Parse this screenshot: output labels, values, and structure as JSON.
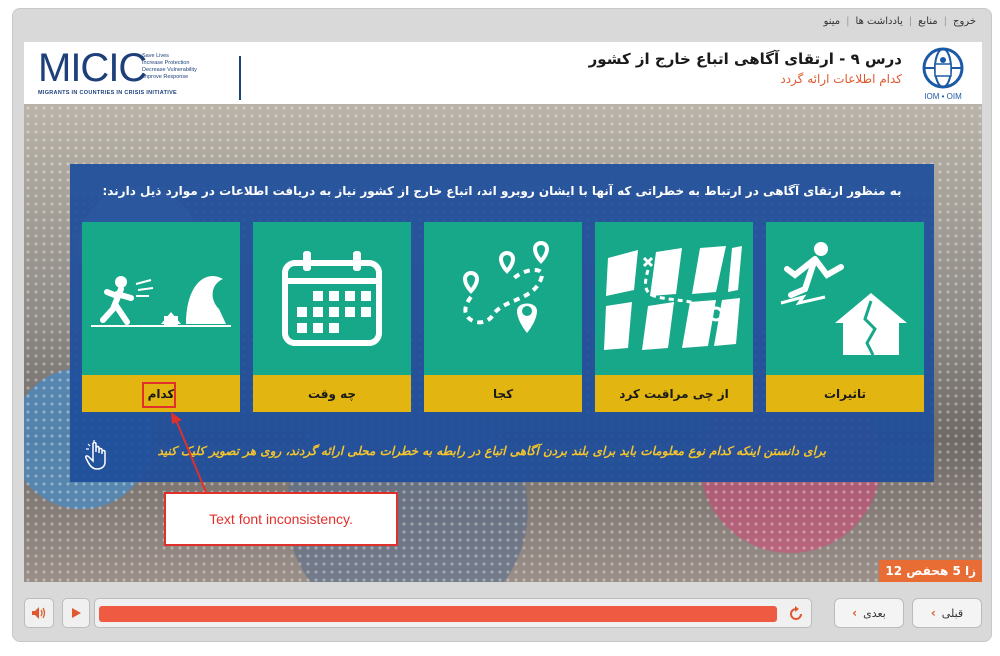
{
  "topnav": {
    "exit": "خروج",
    "resources": "منابع",
    "notes": "یادداشت ها",
    "menu": "مینو"
  },
  "header": {
    "title": "درس ۹ - ارتقای آگاهی اتباع خارج از کشور",
    "subtitle": "کدام اطلاعات ارائه گردد",
    "micic_logo": "MICIC",
    "micic_tagline": [
      "Save Lives",
      "Increase Protection",
      "Decrease Vulnerability",
      "Improve Response"
    ],
    "micic_subtitle": "MIGRANTS IN COUNTRIES IN CRISIS INITIATIVE",
    "iom_label": "IOM • OIM"
  },
  "panel": {
    "instruction": "به منظور ارتقای آگاهی در ارتباط به خطراتی که آنها با ایشان روبرو اند، اتباع خارج از کشور نیاز به دریافت اطلاعات در موارد ذیل دارند:",
    "tiles": [
      {
        "label": "تاثیرات",
        "icon": "falling-person-broken-house-icon"
      },
      {
        "label": "از چی مراقبت کرد",
        "icon": "map-route-icon"
      },
      {
        "label": "کجا",
        "icon": "location-pins-route-icon"
      },
      {
        "label": "چه وقت",
        "icon": "calendar-icon"
      },
      {
        "label": "کدام",
        "icon": "person-fleeing-tsunami-icon"
      }
    ],
    "hint": "برای دانستن اینکه کدام نوع معلومات باید برای بلند بردن آگاهی اتباع در رابطه به خطرات محلی ارائه گردند، روی هر تصویر کلیک کنید"
  },
  "annotation": {
    "note": "Text font inconsistency."
  },
  "footer": {
    "page_counter": "12 زا 5 هحفص",
    "next_label": "بعدی",
    "prev_label": "قبلی",
    "progress": 1.0
  },
  "colors": {
    "tile_green": "#17a889",
    "tile_yellow": "#e2b510",
    "panel_blue": "#1f4f9c",
    "accent_orange": "#e0582e",
    "progress_red": "#ef5a42"
  }
}
